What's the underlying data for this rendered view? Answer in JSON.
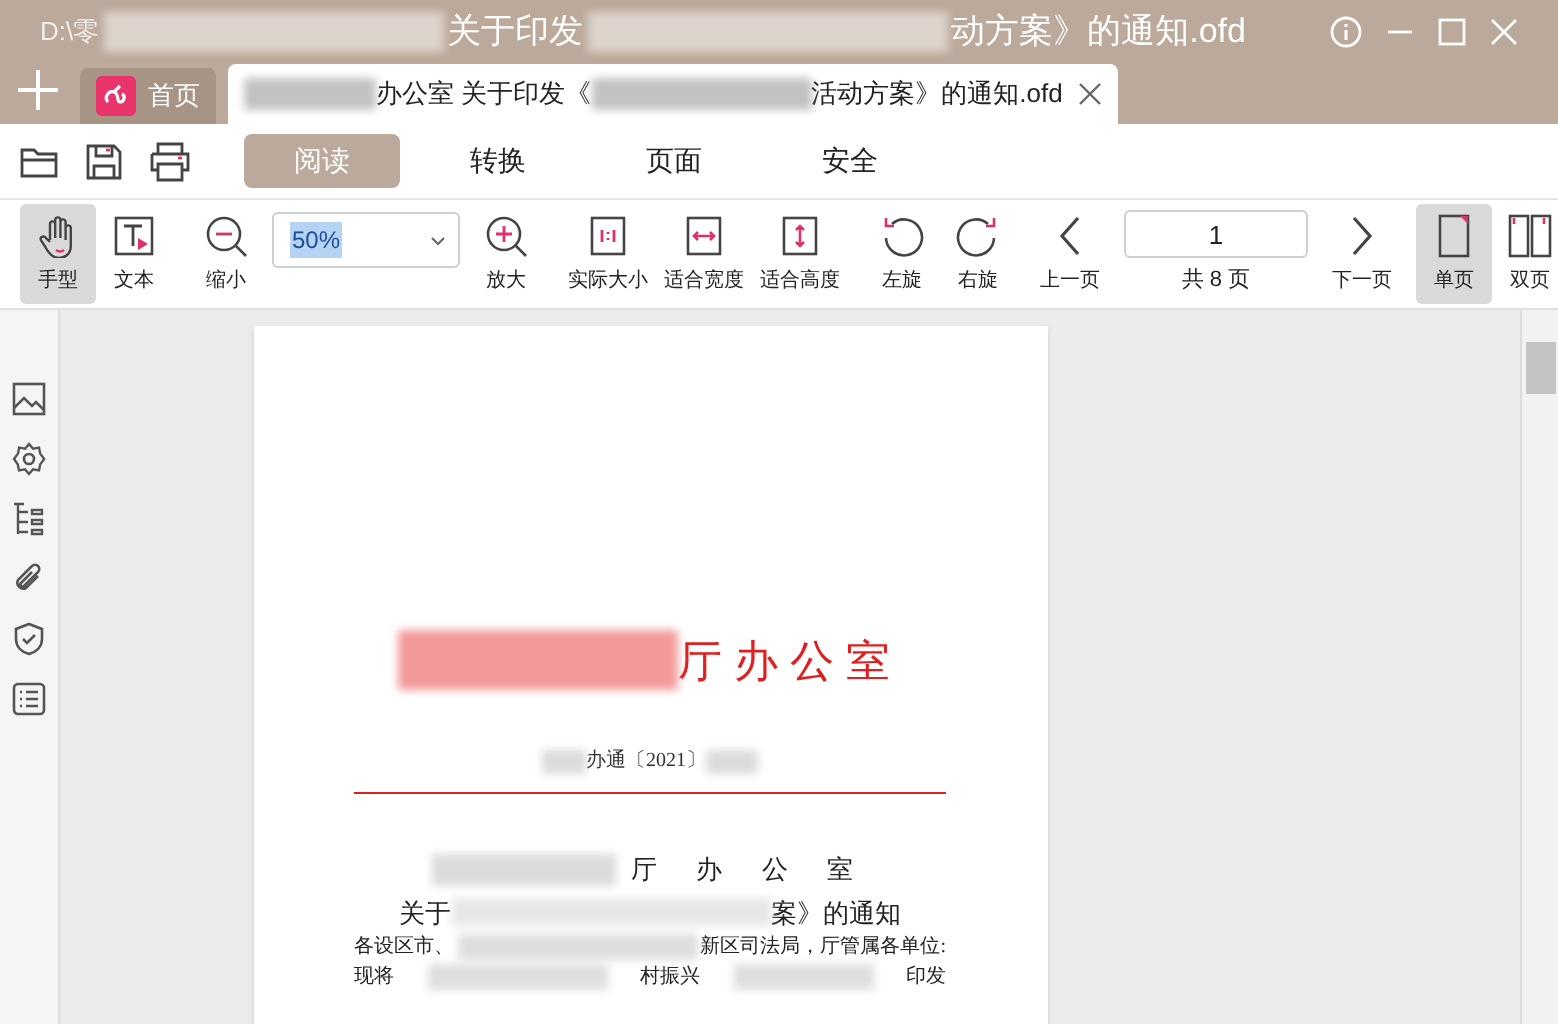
{
  "title_bar": {
    "segments": [
      {
        "kind": "text",
        "text": "D:\\零"
      },
      {
        "kind": "redacted"
      },
      {
        "kind": "text",
        "text": "关于印发"
      },
      {
        "kind": "redacted"
      },
      {
        "kind": "text",
        "text": "动方案》的通知.ofd"
      }
    ]
  },
  "tabs": [
    {
      "kind": "home",
      "label": "首页",
      "selected": false
    },
    {
      "kind": "document",
      "selected": true,
      "segments": [
        {
          "kind": "redacted"
        },
        {
          "kind": "text",
          "text": "办公室 关于印发《"
        },
        {
          "kind": "redacted"
        },
        {
          "kind": "text",
          "text": "活动方案》的通知.ofd"
        }
      ]
    }
  ],
  "menu": [
    {
      "label": "阅读",
      "selected": true
    },
    {
      "label": "转换",
      "selected": false
    },
    {
      "label": "页面",
      "selected": false
    },
    {
      "label": "安全",
      "selected": false
    }
  ],
  "toolbar": [
    [
      {
        "kind": "tool",
        "label": "手型",
        "selected": true
      },
      {
        "kind": "tool",
        "label": "文本",
        "selected": false
      }
    ],
    [
      {
        "kind": "tool",
        "label": "缩小",
        "selected": false
      },
      {
        "kind": "zoom",
        "value": "50%"
      },
      {
        "kind": "tool",
        "label": "放大",
        "selected": false
      }
    ],
    [
      {
        "kind": "tool",
        "label": "实际大小",
        "selected": false
      },
      {
        "kind": "tool",
        "label": "适合宽度",
        "selected": false
      },
      {
        "kind": "tool",
        "label": "适合高度",
        "selected": false
      }
    ],
    [
      {
        "kind": "tool",
        "label": "左旋",
        "selected": false
      },
      {
        "kind": "tool",
        "label": "右旋",
        "selected": false
      }
    ],
    [
      {
        "kind": "tool",
        "label": "上一页",
        "selected": false
      },
      {
        "kind": "page",
        "value": "1",
        "total": "共 8 页"
      },
      {
        "kind": "tool",
        "label": "下一页",
        "selected": false
      }
    ],
    [
      {
        "kind": "tool",
        "label": "单页",
        "selected": true
      },
      {
        "kind": "tool",
        "label": "双页",
        "selected": false
      }
    ]
  ],
  "document": {
    "letterhead": {
      "segments": [
        {
          "kind": "redacted"
        },
        {
          "kind": "text",
          "text": "厅办公室"
        }
      ]
    },
    "doc_number": {
      "segments": [
        {
          "kind": "redacted"
        },
        {
          "kind": "text",
          "text": "办通〔2021〕"
        },
        {
          "kind": "redacted"
        }
      ]
    },
    "title_lines": [
      {
        "segments": [
          {
            "kind": "redacted"
          },
          {
            "kind": "text",
            "text": "厅 办 公 室"
          }
        ]
      },
      {
        "segments": [
          {
            "kind": "text",
            "text": "关于"
          },
          {
            "kind": "redacted"
          },
          {
            "kind": "text",
            "text": "案》的通知"
          }
        ]
      }
    ],
    "body_lines": [
      {
        "segments": [
          {
            "kind": "text",
            "text": "各设区市、"
          },
          {
            "kind": "redacted"
          },
          {
            "kind": "text",
            "text": "新区司法局，厅管属各单位:"
          }
        ]
      },
      {
        "segments": [
          {
            "kind": "text",
            "text": "现将"
          },
          {
            "kind": "redacted"
          },
          {
            "kind": "text",
            "text": "村振兴"
          },
          {
            "kind": "redacted"
          },
          {
            "kind": "text",
            "text": "印发"
          }
        ]
      }
    ]
  }
}
